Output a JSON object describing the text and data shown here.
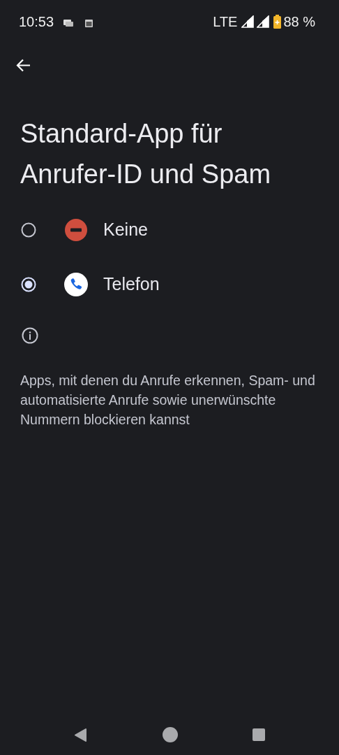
{
  "status_bar": {
    "time": "10:53",
    "network": "LTE",
    "battery": "88 %"
  },
  "title": "Standard-App für Anrufer-ID und Spam",
  "options": [
    {
      "label": "Keine",
      "kind": "none",
      "selected": false
    },
    {
      "label": "Telefon",
      "kind": "phone",
      "selected": true
    }
  ],
  "description": "Apps, mit denen du Anrufe erkennen, Spam- und automatisierte Anrufe sowie unerwünschte Nummern blockieren kannst"
}
